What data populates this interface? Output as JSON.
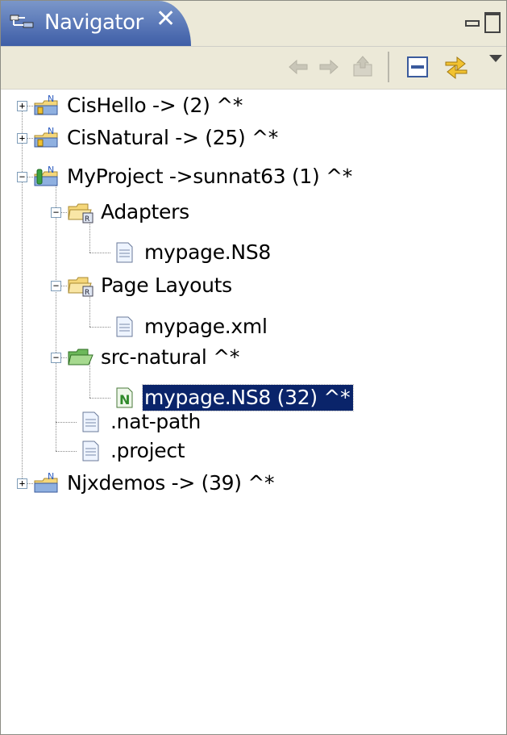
{
  "view": {
    "title": "Navigator",
    "close_icon": "close-icon",
    "minimize_icon": "minimize-icon",
    "maximize_icon": "maximize-icon"
  },
  "toolbar": {
    "buttons": [
      {
        "name": "back",
        "icon": "back-arrow-icon",
        "enabled": false
      },
      {
        "name": "forward",
        "icon": "forward-arrow-icon",
        "enabled": false
      },
      {
        "name": "up",
        "icon": "up-folder-icon",
        "enabled": false
      },
      {
        "name": "collapse-all",
        "icon": "collapse-all-icon",
        "enabled": true
      },
      {
        "name": "link-with-editor",
        "icon": "link-with-editor-icon",
        "enabled": true
      },
      {
        "name": "view-menu",
        "icon": "view-menu-triangle-icon",
        "enabled": true
      }
    ]
  },
  "tree": {
    "items": [
      {
        "label": "CisHello -> (2) ^*",
        "icon": "natural-project-closed-icon",
        "expanded": false
      },
      {
        "label": "CisNatural -> (25) ^*",
        "icon": "natural-project-closed-icon",
        "expanded": false
      },
      {
        "label": "MyProject ->sunnat63 (1) ^*",
        "icon": "natural-project-open-icon",
        "expanded": true
      },
      {
        "label": "Adapters",
        "icon": "folder-icon",
        "expanded": true
      },
      {
        "label": "mypage.NS8",
        "icon": "file-icon"
      },
      {
        "label": "Page Layouts",
        "icon": "folder-icon",
        "expanded": true
      },
      {
        "label": "mypage.xml",
        "icon": "file-icon"
      },
      {
        "label": "src-natural ^*",
        "icon": "source-folder-icon",
        "expanded": true
      },
      {
        "label": "mypage.NS8 (32) ^*",
        "icon": "natural-source-icon",
        "selected": true
      },
      {
        "label": ".nat-path",
        "icon": "file-icon"
      },
      {
        "label": ".project",
        "icon": "file-icon"
      },
      {
        "label": "Njxdemos -> (39) ^*",
        "icon": "natural-project-closed-icon",
        "expanded": false
      }
    ]
  },
  "colors": {
    "tab_active": "#5977b7",
    "selection": "#0a246a",
    "toolbar_bg": "#ece9d8"
  }
}
